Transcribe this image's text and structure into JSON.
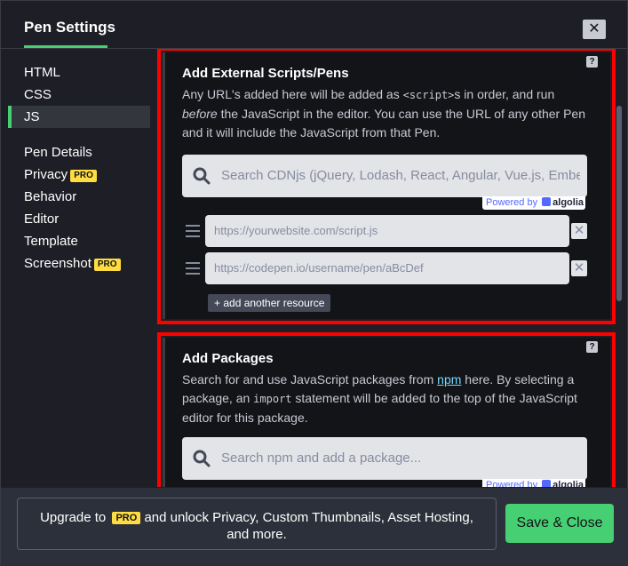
{
  "header": {
    "title": "Pen Settings",
    "close_label": "✕"
  },
  "sidebar": {
    "items_top": [
      {
        "label": "HTML",
        "active": false
      },
      {
        "label": "CSS",
        "active": false
      },
      {
        "label": "JS",
        "active": true
      }
    ],
    "items_bottom": [
      {
        "label": "Pen Details",
        "pro": false
      },
      {
        "label": "Privacy",
        "pro": true
      },
      {
        "label": "Behavior",
        "pro": false
      },
      {
        "label": "Editor",
        "pro": false
      },
      {
        "label": "Template",
        "pro": false
      },
      {
        "label": "Screenshot",
        "pro": true
      }
    ],
    "pro_label": "PRO"
  },
  "external": {
    "help": "?",
    "title": "Add External Scripts/Pens",
    "desc_1": "Any URL's added here will be added as ",
    "desc_code": "<script>",
    "desc_2": "s in order, and run ",
    "desc_em": "before",
    "desc_3": " the JavaScript in the editor. You can use the URL of any other Pen and it will include the JavaScript from that Pen.",
    "search_placeholder": "Search CDNjs (jQuery, Lodash, React, Angular, Vue.js, Ember...",
    "powered_by": "Powered by",
    "algolia": "algolia",
    "resources": [
      {
        "placeholder": "https://yourwebsite.com/script.js"
      },
      {
        "placeholder": "https://codepen.io/username/pen/aBcDef"
      }
    ],
    "remove_label": "✕",
    "add_resource": "+ add another resource"
  },
  "packages": {
    "help": "?",
    "title": "Add Packages",
    "desc_1": "Search for and use JavaScript packages from ",
    "desc_link": "npm",
    "desc_2": " here. By selecting a package, an ",
    "desc_code": "import",
    "desc_3": " statement will be added to the top of the JavaScript editor for this package.",
    "search_placeholder": "Search npm and add a package...",
    "powered_by": "Powered by",
    "algolia": "algolia"
  },
  "footer": {
    "upgrade_1": "Upgrade to ",
    "upgrade_pro": "PRO",
    "upgrade_2": " and unlock Privacy, Custom Thumbnails, Asset Hosting, and more.",
    "save_label": "Save & Close"
  },
  "colors": {
    "accent": "#47cf73",
    "highlight": "#ff0000",
    "pro": "#ffdd40"
  }
}
